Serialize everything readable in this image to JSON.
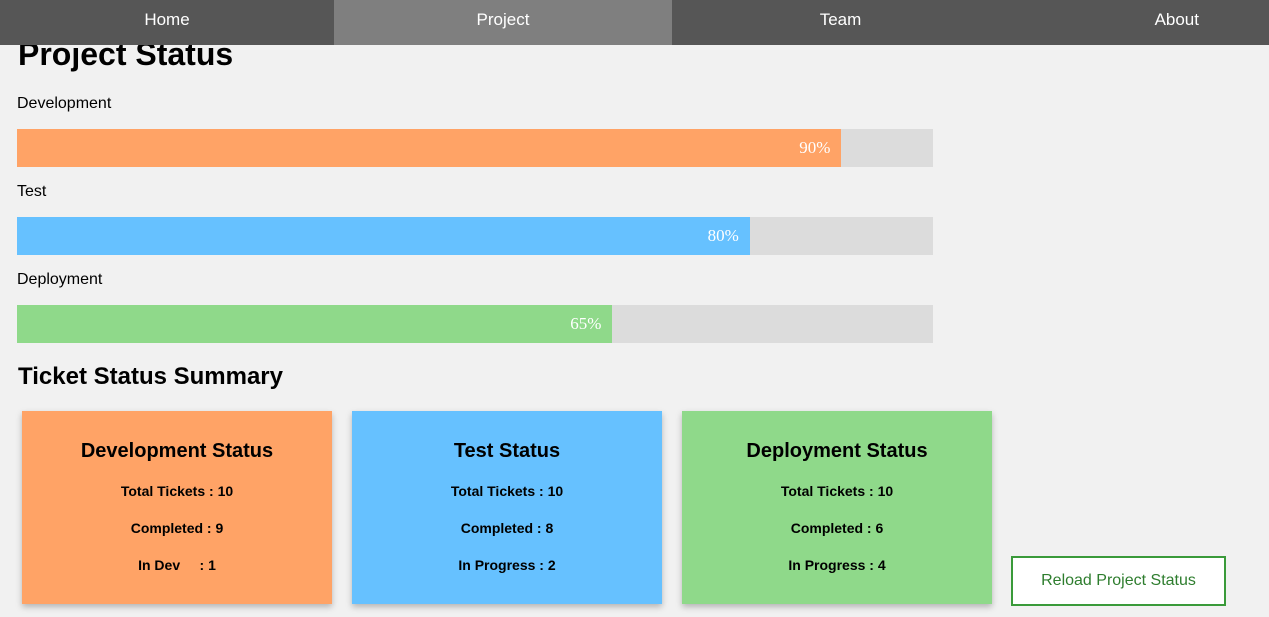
{
  "nav": {
    "items": [
      {
        "label": "Home"
      },
      {
        "label": "Project"
      },
      {
        "label": "Team"
      },
      {
        "label": "About"
      }
    ],
    "active": "Project"
  },
  "page_title": "Project Status",
  "progress": [
    {
      "label": "Development",
      "percent_label": "90%",
      "value": 0.9,
      "color": "#ffa366"
    },
    {
      "label": "Test",
      "percent_label": "80%",
      "value": 0.8,
      "color": "#66c1ff"
    },
    {
      "label": "Deployment",
      "percent_label": "65%",
      "value": 0.65,
      "color": "#8fd98a"
    }
  ],
  "summary_title": "Ticket Status Summary",
  "cards": [
    {
      "title": "Development Status",
      "color": "#ffa366",
      "lines": [
        "Total Tickets : 10",
        "Completed : 9",
        "In Dev     : 1"
      ]
    },
    {
      "title": "Test Status",
      "color": "#66c1ff",
      "lines": [
        "Total Tickets : 10",
        "Completed : 8",
        "In Progress : 2"
      ]
    },
    {
      "title": "Deployment Status",
      "color": "#8fd98a",
      "lines": [
        "Total Tickets : 10",
        "Completed : 6",
        "In Progress : 4"
      ]
    }
  ],
  "reload_button": {
    "label": "Reload Project Status"
  }
}
